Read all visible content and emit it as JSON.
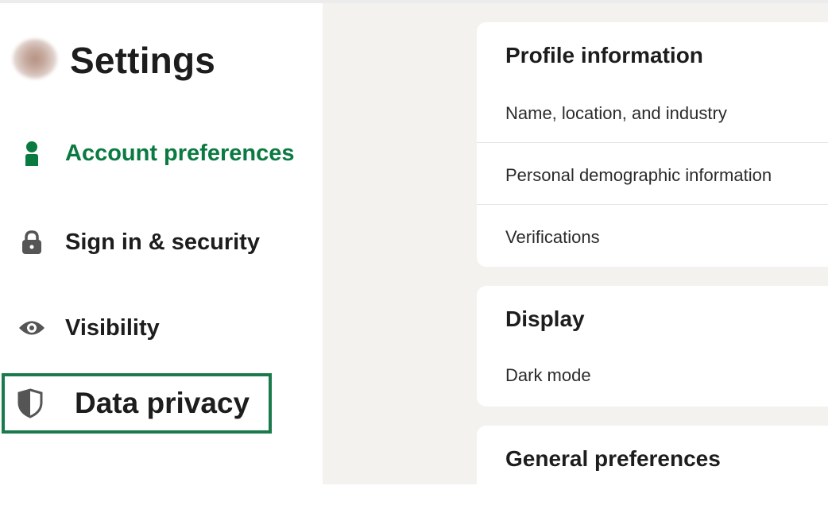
{
  "sidebar": {
    "title": "Settings",
    "nav": {
      "account_preferences": "Account preferences",
      "sign_in_security": "Sign in & security",
      "visibility": "Visibility",
      "data_privacy": "Data privacy"
    },
    "icons": {
      "account": "person-icon",
      "security": "lock-icon",
      "visibility": "eye-icon",
      "privacy": "shield-icon"
    },
    "active_color": "#0a7a41",
    "highlight_color": "#1a7a4b"
  },
  "main": {
    "profile_card": {
      "title": "Profile information",
      "rows": [
        "Name, location, and industry",
        "Personal demographic information",
        "Verifications"
      ]
    },
    "display_card": {
      "title": "Display",
      "rows": [
        "Dark mode"
      ]
    },
    "general_card": {
      "title": "General preferences"
    }
  }
}
